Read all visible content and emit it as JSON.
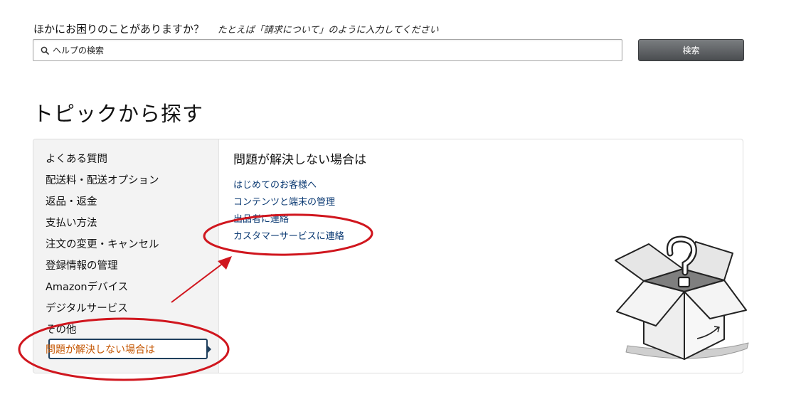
{
  "search": {
    "heading": "ほかにお困りのことがありますか？",
    "hint": "たとえば「請求について」のように入力してください",
    "placeholder": "ヘルプの検索",
    "button_label": "検索"
  },
  "section_title": "トピックから探す",
  "sidebar": {
    "items": [
      {
        "label": "よくある質問"
      },
      {
        "label": "配送料・配送オプション"
      },
      {
        "label": "返品・返金"
      },
      {
        "label": "支払い方法"
      },
      {
        "label": "注文の変更・キャンセル"
      },
      {
        "label": "登録情報の管理"
      },
      {
        "label": "Amazonデバイス"
      },
      {
        "label": "デジタルサービス"
      },
      {
        "label": "その他"
      },
      {
        "label": "問題が解決しない場合は",
        "selected": true
      }
    ]
  },
  "content": {
    "title": "問題が解決しない場合は",
    "links": [
      {
        "label": "はじめてのお客様へ"
      },
      {
        "label": "コンテンツと端末の管理"
      },
      {
        "label": "出品者に連絡"
      },
      {
        "label": "カスタマーサービスに連絡"
      }
    ]
  },
  "colors": {
    "link": "#0b3a73",
    "selected_text": "#c45500",
    "annotation": "#d0161e",
    "button": "#5a5d60"
  },
  "icons": [
    "search-icon",
    "question-box-illustration"
  ]
}
